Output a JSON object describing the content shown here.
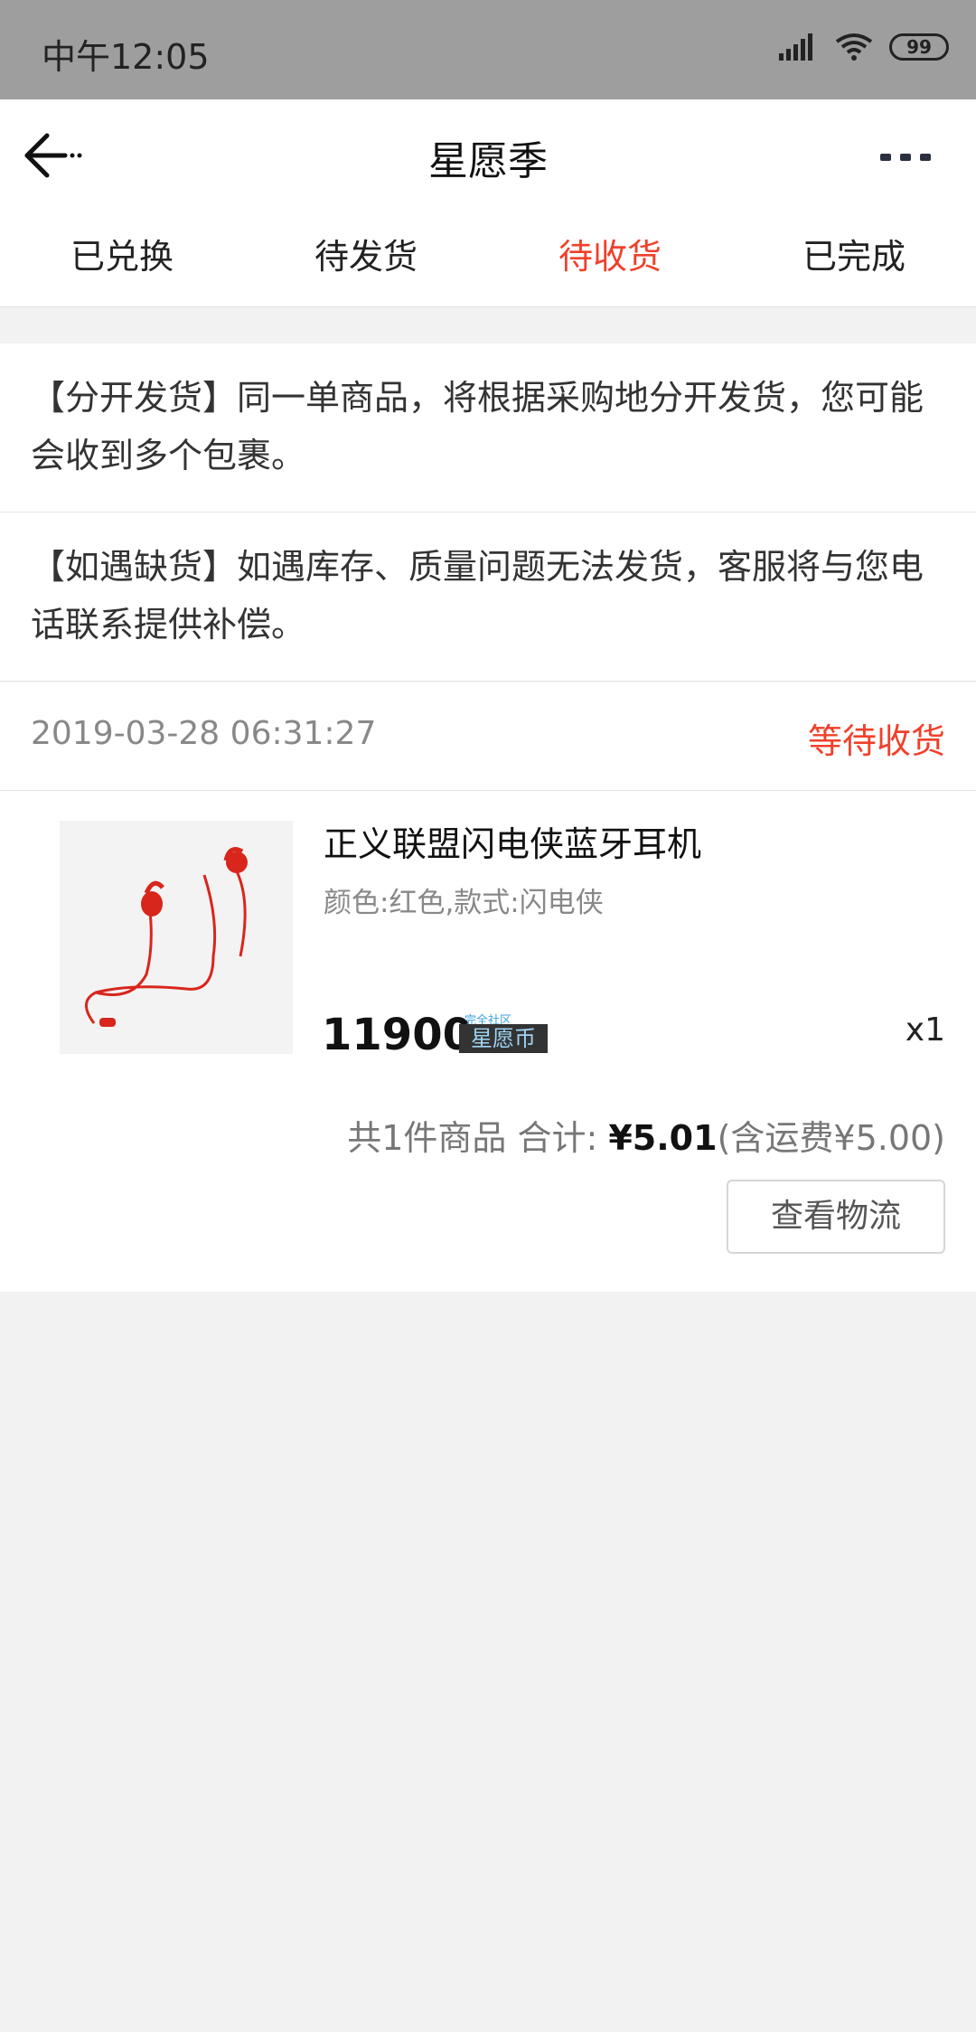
{
  "status_bar": {
    "time": "中午12:05",
    "battery": "99"
  },
  "nav": {
    "title": "星愿季"
  },
  "tabs": [
    {
      "label": "已兑换",
      "active": false
    },
    {
      "label": "待发货",
      "active": false
    },
    {
      "label": "待收货",
      "active": true
    },
    {
      "label": "已完成",
      "active": false
    }
  ],
  "notices": [
    {
      "text": "【分开发货】同一单商品，将根据采购地分开发货，您可能会收到多个包裹。"
    },
    {
      "text": "【如遇缺货】如遇库存、质量问题无法发货，客服将与您电话联系提供补偿。"
    }
  ],
  "order": {
    "date": "2019-03-28 06:31:27",
    "status": "等待收货",
    "product": {
      "name": "正义联盟闪电侠蓝牙耳机",
      "spec": "颜色:红色,款式:闪电侠",
      "price": "11900",
      "coin_top": "完全社区",
      "coin_label": "星愿币",
      "qty": "x1"
    },
    "summary_prefix": "共1件商品 合计: ",
    "total": "¥5.01",
    "shipping": "(含运费¥5.00)",
    "logistics_button": "查看物流"
  },
  "colors": {
    "accent": "#f0402b",
    "status_bar": "#9e9e9e",
    "background": "#f2f2f2"
  }
}
